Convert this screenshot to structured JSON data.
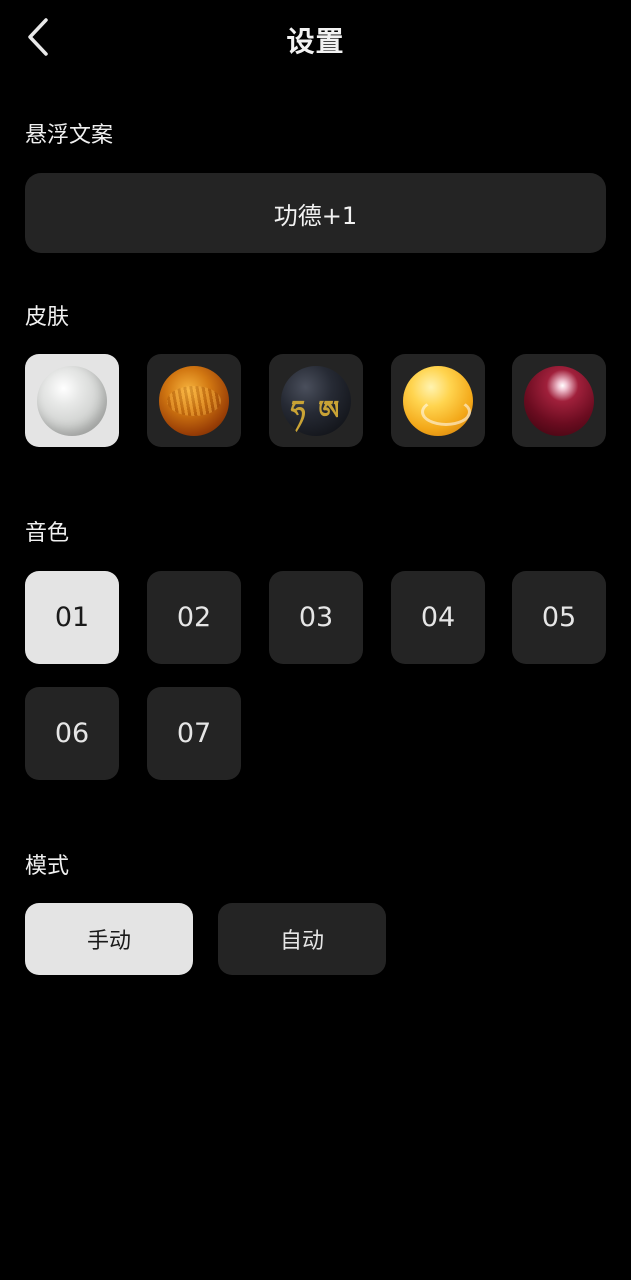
{
  "header": {
    "title": "设置",
    "back_icon": "chevron-left-icon"
  },
  "caption": {
    "label": "悬浮文案",
    "value": "功德+1"
  },
  "skins": {
    "label": "皮肤",
    "selected_index": 0,
    "items": [
      {
        "name": "white-jade-bead"
      },
      {
        "name": "amber-tiger-eye-bead"
      },
      {
        "name": "black-mantra-bead",
        "glyph": "ཧ ཨ"
      },
      {
        "name": "yellow-agate-bead"
      },
      {
        "name": "garnet-red-bead"
      }
    ]
  },
  "sounds": {
    "label": "音色",
    "selected_index": 0,
    "items": [
      "01",
      "02",
      "03",
      "04",
      "05",
      "06",
      "07"
    ]
  },
  "mode": {
    "label": "模式",
    "selected_index": 0,
    "options": [
      "手动",
      "自动"
    ]
  },
  "colors": {
    "background": "#000000",
    "tile": "#242424",
    "selected_tile": "#e4e4e4",
    "text": "#f2f2f2"
  }
}
